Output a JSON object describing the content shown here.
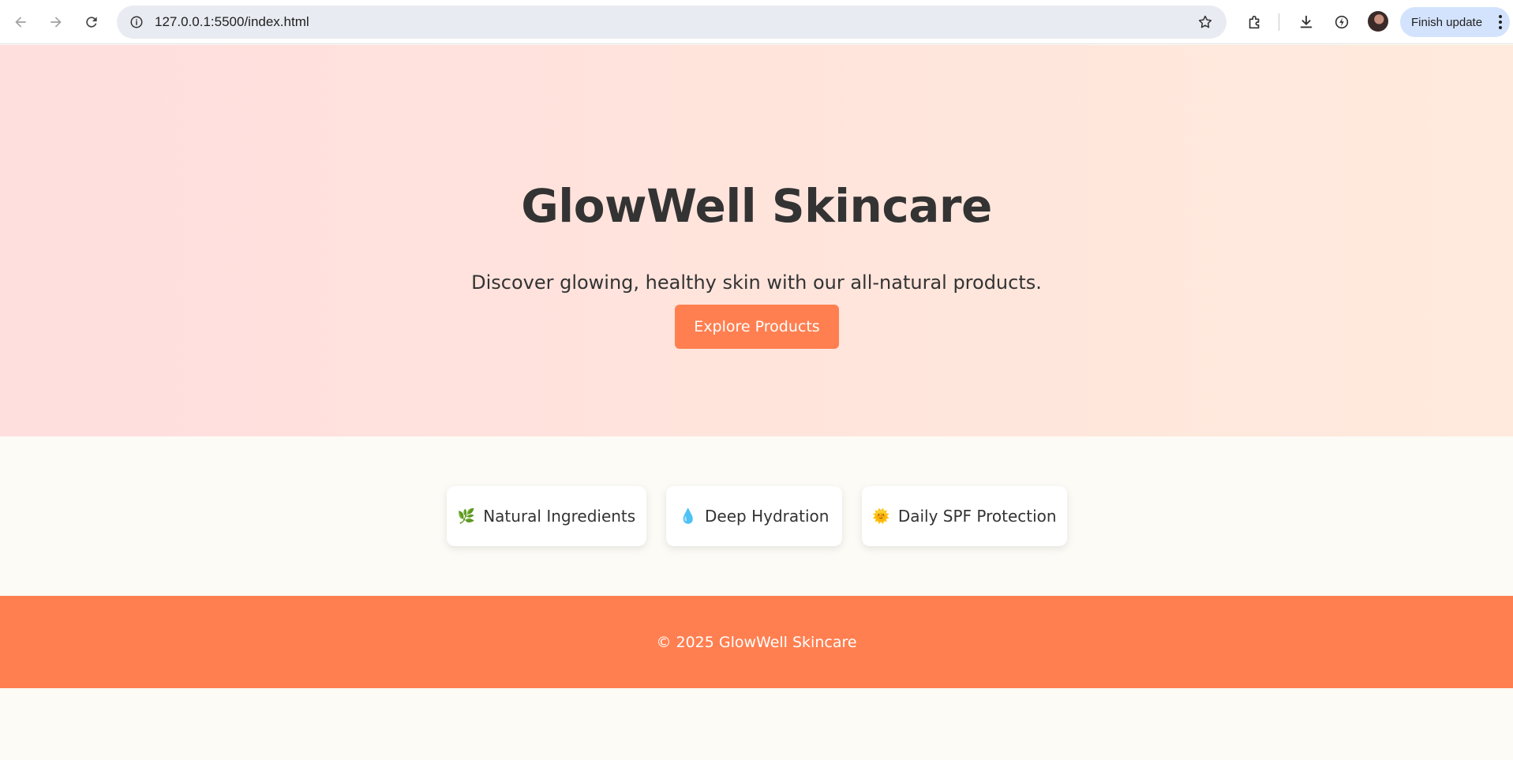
{
  "browser": {
    "url": "127.0.0.1:5500/index.html",
    "update_label": "Finish update"
  },
  "hero": {
    "title": "GlowWell Skincare",
    "subtitle": "Discover glowing, healthy skin with our all-natural products.",
    "cta_label": "Explore Products"
  },
  "features": [
    {
      "icon": "🌿",
      "icon_name": "leaf-icon",
      "label": "Natural Ingredients"
    },
    {
      "icon": "💧",
      "icon_name": "droplet-icon",
      "label": "Deep Hydration"
    },
    {
      "icon": "🌞",
      "icon_name": "sun-icon",
      "label": "Daily SPF Protection"
    }
  ],
  "footer": {
    "text": "© 2025 GlowWell Skincare"
  },
  "colors": {
    "accent": "#ff7f50",
    "text": "#333333",
    "hero_start": "#ffdede",
    "hero_end": "#ffeadd",
    "page_bg": "#fdfbf6"
  }
}
